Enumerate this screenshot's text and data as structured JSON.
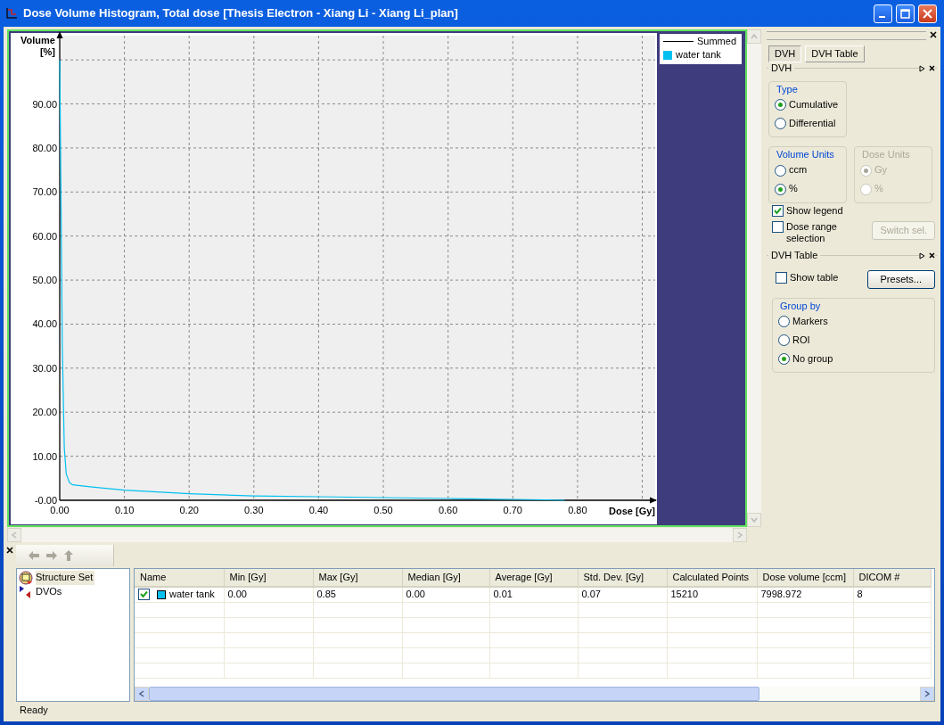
{
  "window": {
    "title": "Dose Volume Histogram, Total dose [Thesis Electron - Xiang Li - Xiang Li_plan]"
  },
  "chart": {
    "legend": [
      {
        "label": "Summed",
        "kind": "line"
      }
    ],
    "chart_data": {
      "type": "line",
      "grid": true,
      "xlabel": "Dose [Gy]",
      "ylabel": "Volume [%]",
      "x": [
        0,
        0.002,
        0.004,
        0.007,
        0.01,
        0.015,
        0.02,
        0.05,
        0.1,
        0.2,
        0.3,
        0.4,
        0.5,
        0.6,
        0.7,
        0.75,
        0.78
      ],
      "series": [
        {
          "name": "water tank",
          "color": "#00c0f0",
          "values": [
            100,
            67,
            35,
            12,
            6,
            4,
            3.5,
            3,
            2.3,
            1.5,
            1,
            0.8,
            0.6,
            0.4,
            0.2,
            0.1,
            0
          ]
        }
      ],
      "xlim": [
        0,
        0.92
      ],
      "ylim": [
        0,
        105.5
      ],
      "xticks": [
        {
          "value": 0,
          "label": "0.00"
        },
        {
          "value": 0.1,
          "label": "0.10"
        },
        {
          "value": 0.2,
          "label": "0.20"
        },
        {
          "value": 0.3,
          "label": "0.30"
        },
        {
          "value": 0.4,
          "label": "0.40"
        },
        {
          "value": 0.5,
          "label": "0.50"
        },
        {
          "value": 0.6,
          "label": "0.60"
        },
        {
          "value": 0.7,
          "label": "0.70"
        },
        {
          "value": 0.8,
          "label": "0.80"
        }
      ],
      "yticks": [
        {
          "value": 0,
          "label": "-0.00"
        },
        {
          "value": 10,
          "label": "10.00"
        },
        {
          "value": 20,
          "label": "20.00"
        },
        {
          "value": 30,
          "label": "30.00"
        },
        {
          "value": 40,
          "label": "40.00"
        },
        {
          "value": 50,
          "label": "50.00"
        },
        {
          "value": 60,
          "label": "60.00"
        },
        {
          "value": 70,
          "label": "70.00"
        },
        {
          "value": 80,
          "label": "80.00"
        },
        {
          "value": 90,
          "label": "90.00"
        }
      ]
    }
  },
  "side_panel": {
    "tabs": [
      {
        "label": "DVH",
        "selected": true
      },
      {
        "label": "DVH Table",
        "selected": false
      }
    ],
    "dvh": {
      "title": "DVH",
      "type": {
        "title": "Type",
        "options": [
          {
            "label": "Cumulative",
            "selected": true
          },
          {
            "label": "Differential",
            "selected": false
          }
        ]
      },
      "volume_units": {
        "title": "Volume Units",
        "options": [
          {
            "label": "ccm",
            "selected": false
          },
          {
            "label": "%",
            "selected": true
          }
        ]
      },
      "dose_units": {
        "title": "Dose Units",
        "disabled": true,
        "options": [
          {
            "label": "Gy",
            "selected": true
          },
          {
            "label": "%",
            "selected": false
          }
        ]
      },
      "show_legend": {
        "label": "Show legend",
        "checked": true
      },
      "dose_range_selection": {
        "label": "Dose range selection",
        "checked": false
      },
      "switch_button": {
        "label": "Switch sel.",
        "disabled": true
      }
    },
    "dvh_table": {
      "title": "DVH Table",
      "show_table": {
        "label": "Show table",
        "checked": false
      },
      "presets_button": {
        "label": "Presets...",
        "disabled": false
      },
      "group_by": {
        "title": "Group by",
        "options": [
          {
            "label": "Markers",
            "selected": false
          },
          {
            "label": "ROI",
            "selected": false
          },
          {
            "label": "No group",
            "selected": true
          }
        ]
      }
    }
  },
  "tree": [
    {
      "label": "Structure Set",
      "kind": "structure-set",
      "selected": true
    },
    {
      "label": "DVOs",
      "kind": "dvo",
      "selected": false
    }
  ],
  "table": {
    "columns": [
      "Name",
      "Min [Gy]",
      "Max [Gy]",
      "Median [Gy]",
      "Average [Gy]",
      "Std. Dev. [Gy]",
      "Calculated Points",
      "Dose volume [ccm]",
      "DICOM #"
    ],
    "rows": [
      {
        "checked": true,
        "color": "#00c0f0",
        "cells": [
          "water tank",
          "0.00",
          "0.85",
          "0.00",
          "0.01",
          "0.07",
          "15210",
          "7998.972",
          "8"
        ]
      }
    ]
  },
  "status_bar": "Ready"
}
